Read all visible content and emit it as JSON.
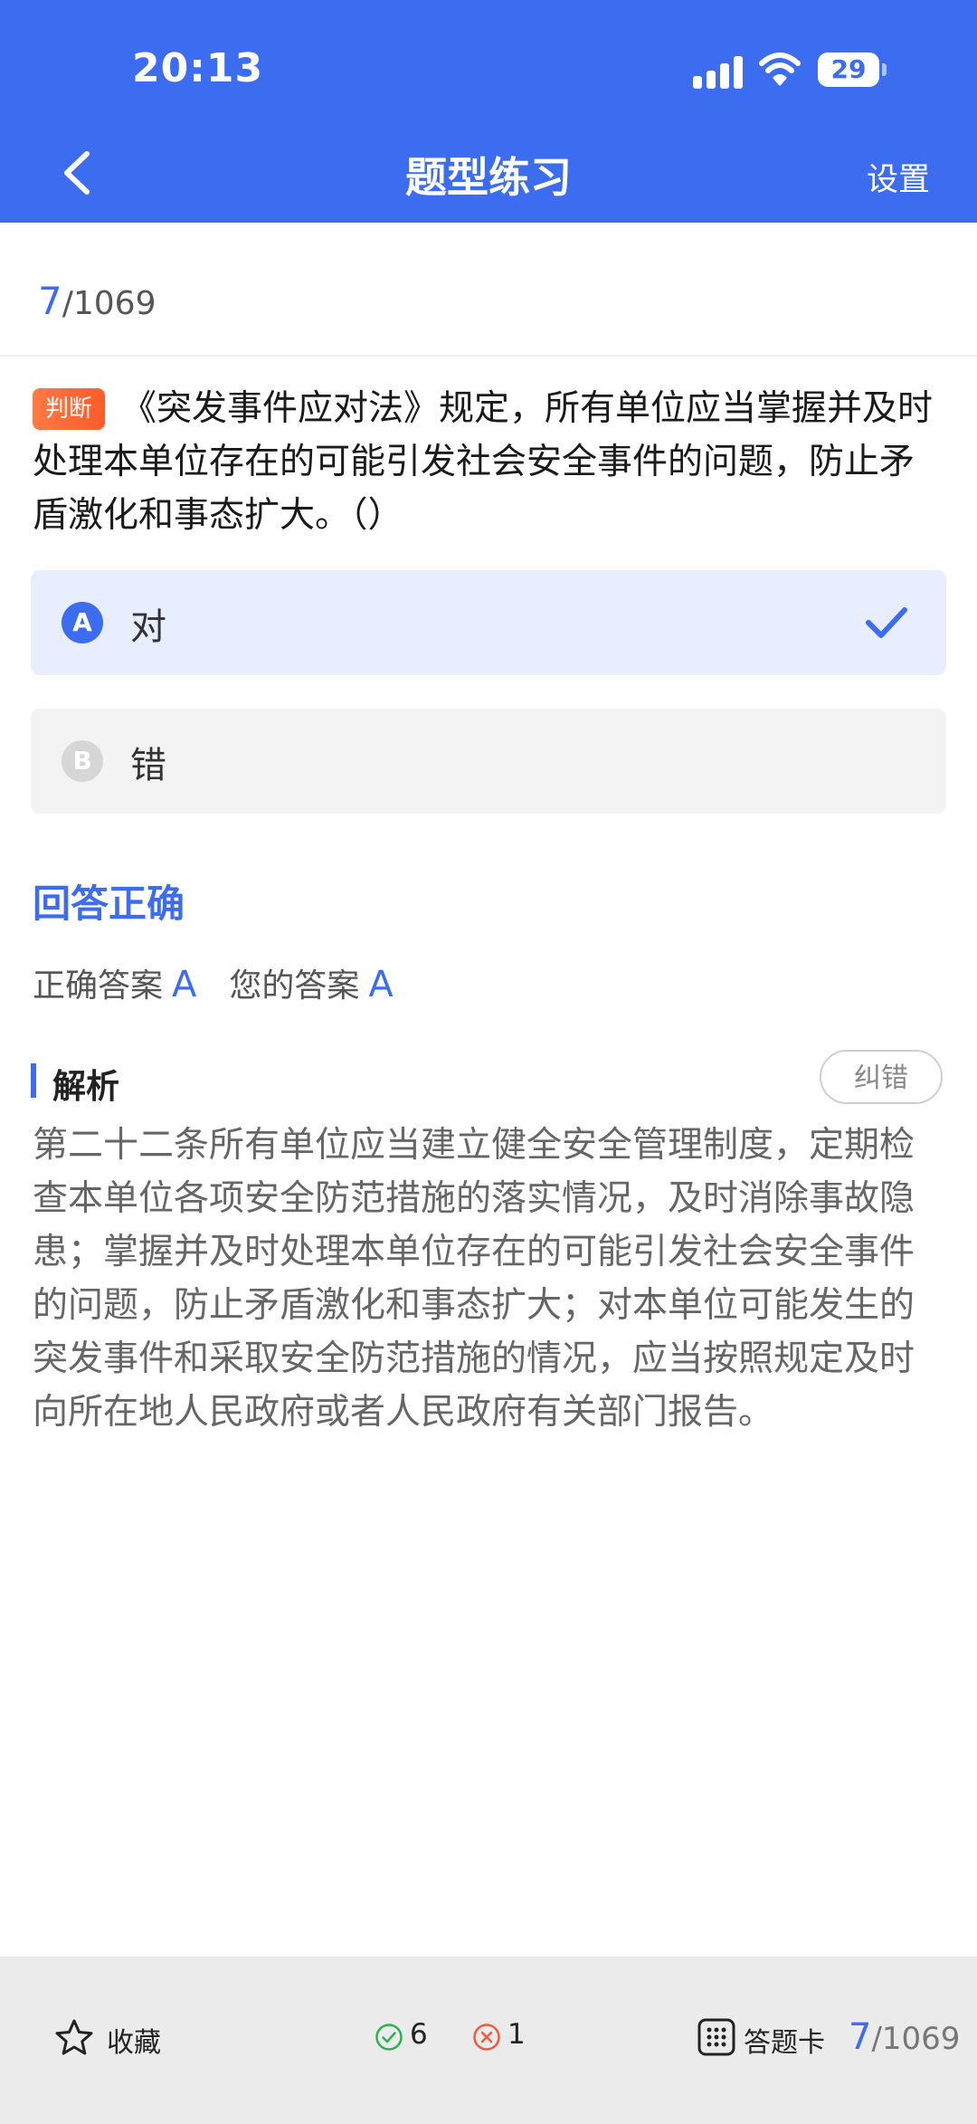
{
  "status_bar": {
    "time": "20:13",
    "battery": "29"
  },
  "nav": {
    "title": "题型练习",
    "settings_label": "设置"
  },
  "progress": {
    "current": "7",
    "total": "/1069"
  },
  "question": {
    "type": "判断",
    "text": "《突发事件应对法》规定，所有单位应当掌握并及时处理本单位存在的可能引发社会安全事件的问题，防止矛盾激化和事态扩大。（）"
  },
  "options": [
    {
      "letter": "A",
      "text": "对",
      "selected": true
    },
    {
      "letter": "B",
      "text": "错",
      "selected": false
    }
  ],
  "result": {
    "status": "回答正确",
    "correct_label": "正确答案",
    "correct_value": "A",
    "your_label": "您的答案",
    "your_value": "A"
  },
  "analysis": {
    "title": "解析",
    "correction_label": "纠错",
    "text": "第二十二条所有单位应当建立健全安全管理制度，定期检查本单位各项安全防范措施的落实情况，及时消除事故隐患；掌握并及时处理本单位存在的可能引发社会安全事件的问题，防止矛盾激化和事态扩大；对本单位可能发生的突发事件和采取安全防范措施的情况，应当按照规定及时向所在地人民政府或者人民政府有关部门报告。"
  },
  "bottom_bar": {
    "favorite_label": "收藏",
    "correct_count": "6",
    "wrong_count": "1",
    "answer_card_label": "答题卡",
    "progress_current": "7",
    "progress_total": "/1069"
  },
  "colors": {
    "primary": "#3c6cf0",
    "badge": "#ff6a3a",
    "correct": "#2bb24c",
    "wrong": "#f05a3a"
  }
}
